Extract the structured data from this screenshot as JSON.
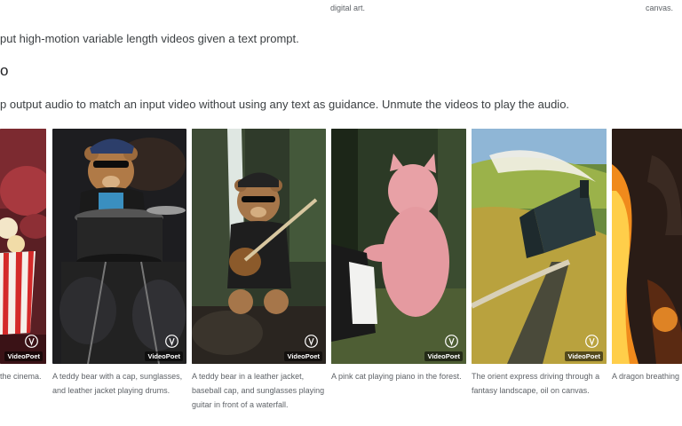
{
  "top_fragments": {
    "left": "",
    "middle": "digital art.",
    "right": "canvas."
  },
  "intro_text": "put high-motion variable length videos given a text prompt.",
  "section_heading": "o",
  "section_text": "p output audio to match an input video without using any text as guidance. Unmute the videos to play the audio.",
  "watermark": "VideoPoet",
  "colors": {
    "text": "#3c4043",
    "caption": "#5f6368"
  },
  "videos": [
    {
      "id": "cinema",
      "caption": "the cinema.",
      "icon": "popcorn-scene"
    },
    {
      "id": "drums",
      "caption": "A teddy bear with a cap, sunglasses, and leather jacket playing drums.",
      "icon": "teddy-drums-scene"
    },
    {
      "id": "guitar",
      "caption": "A teddy bear in a leather jacket, baseball cap, and sunglasses playing guitar in front of a waterfall.",
      "icon": "teddy-guitar-scene"
    },
    {
      "id": "piano",
      "caption": "A pink cat playing piano in the forest.",
      "icon": "cat-piano-scene"
    },
    {
      "id": "train",
      "caption": "The orient express driving through a fantasy landscape, oil on canvas.",
      "icon": "train-scene"
    },
    {
      "id": "dragon",
      "caption": "A dragon breathing",
      "icon": "dragon-scene"
    }
  ]
}
